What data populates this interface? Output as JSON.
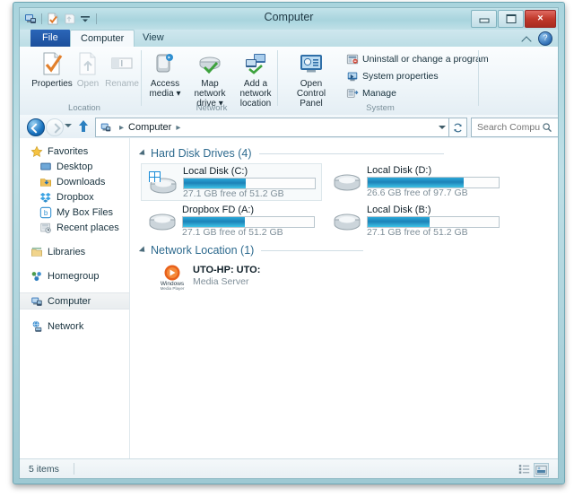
{
  "window": {
    "title": "Computer",
    "quick_access": [
      {
        "name": "computer-icon",
        "label": "Computer"
      },
      {
        "name": "properties-icon",
        "label": "Properties"
      },
      {
        "name": "new-folder-icon",
        "label": "New folder"
      },
      {
        "name": "customize-caret-icon",
        "label": "Customize Quick Access Toolbar"
      }
    ],
    "caption_buttons": {
      "minimize": "Minimize",
      "maximize": "Maximize",
      "close": "×"
    }
  },
  "ribbon": {
    "tabs": [
      {
        "label": "File",
        "type": "file"
      },
      {
        "label": "Computer",
        "type": "active"
      },
      {
        "label": "View",
        "type": "plain"
      }
    ],
    "collapse_label": "Minimize the Ribbon",
    "help_label": "?",
    "groups": [
      {
        "name": "Location",
        "label": "Location",
        "buttons": [
          {
            "label": "Properties",
            "icon": "properties-icon",
            "disabled": false
          },
          {
            "label": "Open",
            "icon": "open-icon",
            "disabled": true
          },
          {
            "label": "Rename",
            "icon": "rename-icon",
            "disabled": true
          }
        ]
      },
      {
        "name": "Network",
        "label": "Network",
        "buttons": [
          {
            "label": "Access media ▾",
            "icon": "access-media-icon",
            "disabled": false
          },
          {
            "label": "Map network drive ▾",
            "icon": "map-network-drive-icon",
            "disabled": false
          },
          {
            "label": "Add a network location",
            "icon": "add-network-location-icon",
            "disabled": false
          }
        ]
      },
      {
        "name": "System",
        "label": "System",
        "buttons": [
          {
            "label": "Open Control Panel",
            "icon": "control-panel-icon",
            "disabled": false
          }
        ],
        "small_items": [
          {
            "label": "Uninstall or change a program",
            "icon": "uninstall-program-icon"
          },
          {
            "label": "System properties",
            "icon": "system-properties-icon"
          },
          {
            "label": "Manage",
            "icon": "manage-icon"
          }
        ]
      }
    ]
  },
  "address_bar": {
    "back_label": "Back",
    "forward_label": "Forward",
    "recent_label": "Recent locations",
    "up_label": "Up",
    "breadcrumb_icon": "computer-icon",
    "breadcrumb": [
      "Computer"
    ],
    "breadcrumb_separator": "▸",
    "dropdown_label": "Previous locations",
    "refresh_label": "Refresh",
    "search": {
      "placeholder": "Search Computer",
      "value": "",
      "icon": "search-icon"
    }
  },
  "sidebar": {
    "items": [
      {
        "label": "Favorites",
        "icon": "star-icon",
        "level": 0,
        "selected": false
      },
      {
        "label": "Desktop",
        "icon": "desktop-icon",
        "level": 1,
        "selected": false
      },
      {
        "label": "Downloads",
        "icon": "downloads-icon",
        "level": 1,
        "selected": false
      },
      {
        "label": "Dropbox",
        "icon": "dropbox-icon",
        "level": 1,
        "selected": false
      },
      {
        "label": "My Box Files",
        "icon": "box-icon",
        "level": 1,
        "selected": false
      },
      {
        "label": "Recent places",
        "icon": "recent-places-icon",
        "level": 1,
        "selected": false
      },
      {
        "label": "Libraries",
        "icon": "libraries-icon",
        "level": 0,
        "selected": false
      },
      {
        "label": "Homegroup",
        "icon": "homegroup-icon",
        "level": 0,
        "selected": false
      },
      {
        "label": "Computer",
        "icon": "computer-icon",
        "level": 0,
        "selected": true
      },
      {
        "label": "Network",
        "icon": "network-icon",
        "level": 0,
        "selected": false
      }
    ]
  },
  "main": {
    "sections": [
      {
        "title": "Hard Disk Drives (4)",
        "name": "hard-disk-drives-section",
        "drives": [
          {
            "name": "Local Disk (C:)",
            "free_text": "27.1 GB free of 51.2 GB",
            "used_percent": 47,
            "selected": true,
            "icon": "windows-drive-icon"
          },
          {
            "name": "Local Disk (D:)",
            "free_text": "26.6 GB free of 97.7 GB",
            "used_percent": 73,
            "selected": false,
            "icon": "hard-drive-icon"
          },
          {
            "name": "Dropbox FD (A:)",
            "free_text": "27.1 GB free of 51.2 GB",
            "used_percent": 47,
            "selected": false,
            "icon": "hard-drive-icon"
          },
          {
            "name": "Local Disk (B:)",
            "free_text": "27.1 GB free of 51.2 GB",
            "used_percent": 47,
            "selected": false,
            "icon": "hard-drive-icon"
          }
        ]
      },
      {
        "title": "Network Location (1)",
        "name": "network-location-section",
        "items": [
          {
            "line1": "UTO-HP: UTO:",
            "line2": "Media Server",
            "icon": "windows-media-player-icon"
          }
        ]
      }
    ]
  },
  "status_bar": {
    "item_count": "5 items",
    "views": [
      {
        "name": "details-view-button",
        "label": "Details view",
        "selected": false
      },
      {
        "name": "large-icons-view-button",
        "label": "Large icons view",
        "selected": true
      }
    ]
  },
  "colors": {
    "accent": "#1c82b8",
    "title_bar": "#a8d4de",
    "file_tab": "#1c4f9c",
    "close_button": "#c0392b",
    "section_title": "#2d6a8e"
  }
}
